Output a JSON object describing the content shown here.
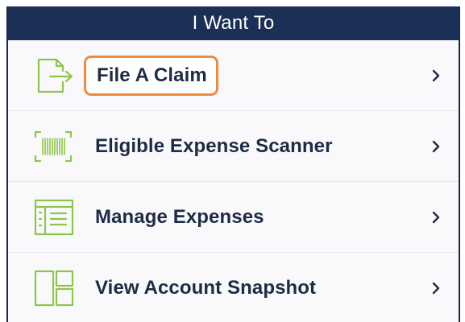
{
  "header": {
    "title": "I Want To"
  },
  "menu": {
    "items": [
      {
        "label": "File A Claim",
        "icon": "file-export-icon",
        "highlighted": true
      },
      {
        "label": "Eligible Expense Scanner",
        "icon": "barcode-scanner-icon",
        "highlighted": false
      },
      {
        "label": "Manage Expenses",
        "icon": "expense-list-icon",
        "highlighted": false
      },
      {
        "label": "View Account Snapshot",
        "icon": "dashboard-layout-icon",
        "highlighted": false
      }
    ]
  },
  "colors": {
    "header_bg": "#1c2f57",
    "icon_green": "#8ec64b",
    "highlight_orange": "#ef8a3d",
    "label_text": "#1e2b45"
  }
}
